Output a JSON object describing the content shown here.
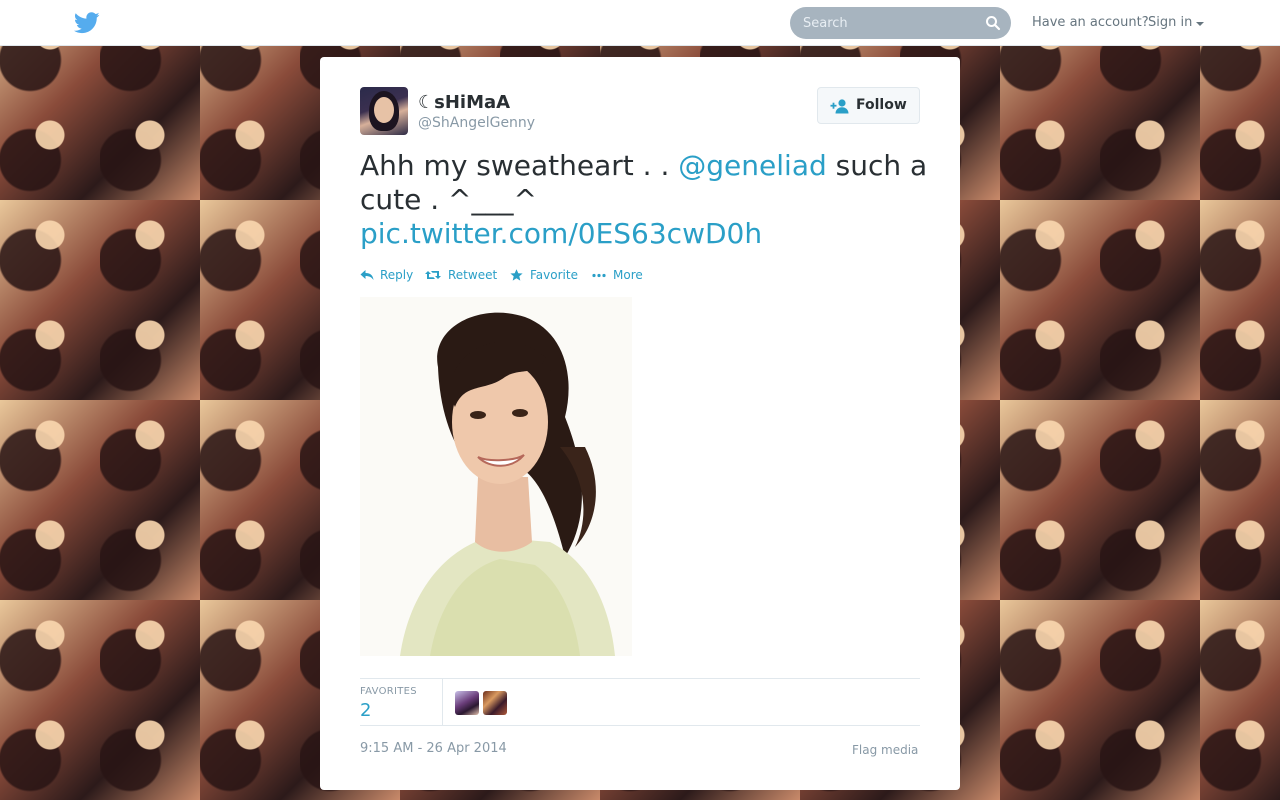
{
  "header": {
    "search_placeholder": "Search",
    "have_account": "Have an account?",
    "sign_in": "Sign in"
  },
  "tweet": {
    "display_name": "☾sHiMaA",
    "handle": "@ShAngelGenny",
    "follow_label": "Follow",
    "text_before": "Ahh my sweatheart . . ",
    "mention": "@geneliad",
    "text_after": "  such a cute . ^___^",
    "link": "pic.twitter.com/0ES63cwD0h",
    "actions": {
      "reply": "Reply",
      "retweet": "Retweet",
      "favorite": "Favorite",
      "more": "More"
    },
    "favorites_label": "FAVORITES",
    "favorites_count": "2",
    "timestamp": "9:15 AM - 26 Apr 2014",
    "flag_media": "Flag media"
  },
  "colors": {
    "link": "#2a9fc7",
    "text": "#292f33",
    "muted": "#8899a6",
    "twitter_blue": "#55acee"
  }
}
